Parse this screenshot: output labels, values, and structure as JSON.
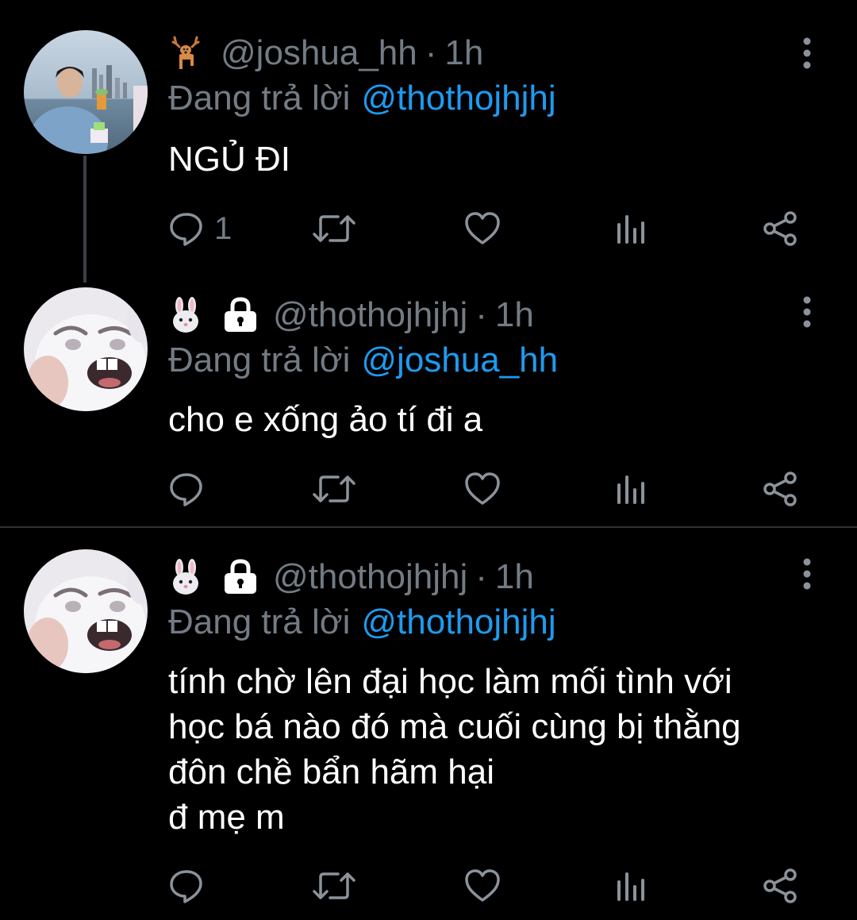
{
  "tweets": [
    {
      "emoji": "deer",
      "locked": false,
      "handle": "@joshua_hh",
      "dot": "·",
      "time": "1h",
      "reply_prefix": "Đang trả lời",
      "reply_to": "@thothojhjhj",
      "body": [
        "NGỦ ĐI"
      ],
      "reply_count": "1"
    },
    {
      "emoji": "rabbit",
      "locked": true,
      "handle": "@thothojhjhj",
      "dot": "·",
      "time": "1h",
      "reply_prefix": "Đang trả lời",
      "reply_to": "@joshua_hh",
      "body": [
        "cho e xống ảo tí đi a"
      ],
      "reply_count": ""
    },
    {
      "emoji": "rabbit",
      "locked": true,
      "handle": "@thothojhjhj",
      "dot": "·",
      "time": "1h",
      "reply_prefix": "Đang trả lời",
      "reply_to": "@thothojhjhj",
      "body": [
        "tính chờ lên đại học làm mối tình với",
        "học bá nào đó mà cuối cùng bị thằng",
        "đôn chề bẩn hãm hại",
        "đ mẹ m"
      ],
      "reply_count": ""
    }
  ],
  "icons": {
    "reply": "reply-icon",
    "retweet": "retweet-icon",
    "like": "heart-icon",
    "views": "views-icon",
    "share": "share-icon",
    "more": "more-vertical-icon"
  },
  "colors": {
    "background": "#000000",
    "muted": "#737b84",
    "link": "#1d9bf0",
    "text": "#ffffff",
    "divider": "#2f3336"
  }
}
